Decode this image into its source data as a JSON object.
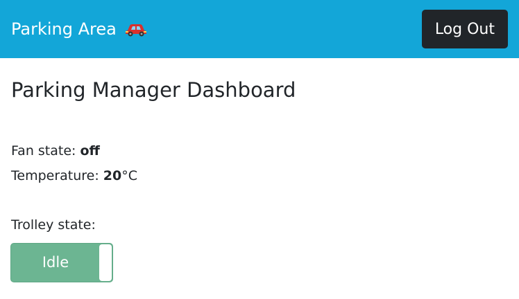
{
  "navbar": {
    "brand_text": "Parking Area",
    "brand_icon": "car-icon",
    "background_color": "#13a6d8",
    "logout_label": "Log Out"
  },
  "main": {
    "title": "Parking Manager Dashboard",
    "fan_label": "Fan state: ",
    "fan_value": "off",
    "temperature_label": "Temperature: ",
    "temperature_value": "20",
    "temperature_unit": "°C",
    "trolley_label": "Trolley state:",
    "trolley_toggle_label": "Idle",
    "trolley_toggle_color": "#6cb592"
  }
}
